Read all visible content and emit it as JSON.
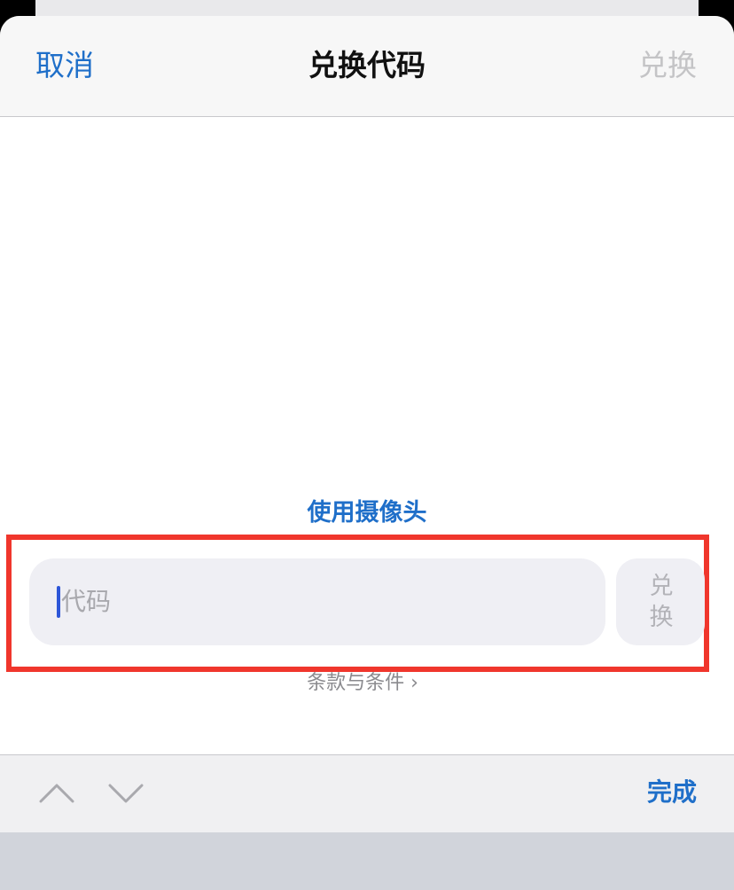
{
  "nav": {
    "cancel_label": "取消",
    "title": "兑换代码",
    "redeem_label": "兑换"
  },
  "camera_link_label": "使用摄像头",
  "code_field": {
    "placeholder": "代码",
    "value": ""
  },
  "redeem_button_label": "兑换",
  "terms_label": "条款与条件 ›",
  "accessory": {
    "prev_icon": "chevron-up-icon",
    "next_icon": "chevron-down-icon",
    "done_label": "完成"
  },
  "colors": {
    "accent": "#1f6fc9",
    "highlight": "#f0362c",
    "disabled_text": "#c4c4c6"
  }
}
